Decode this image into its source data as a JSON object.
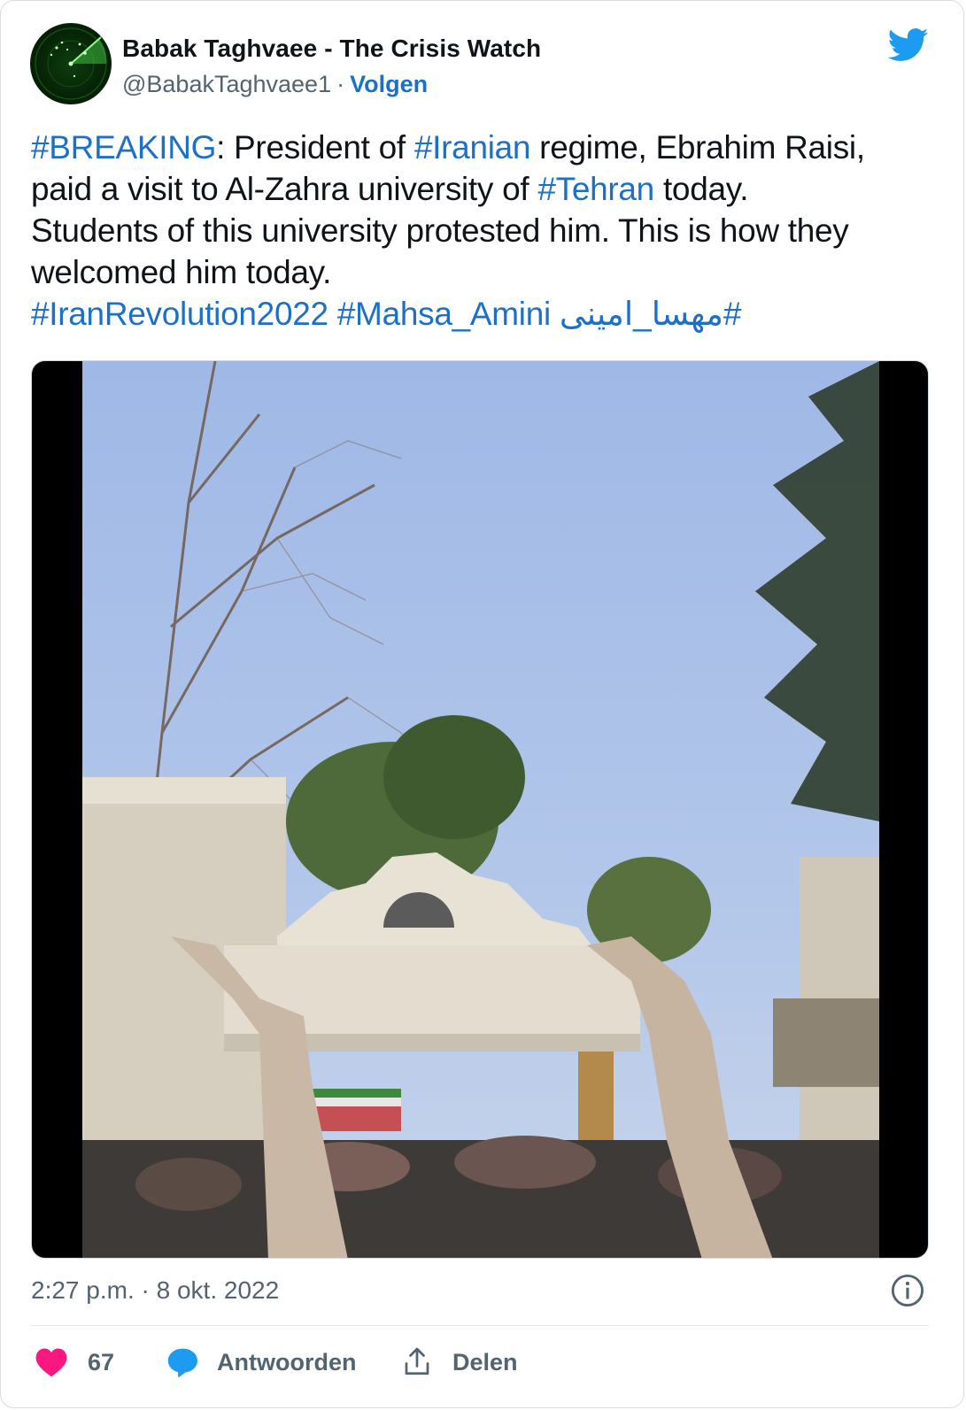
{
  "author": {
    "name": "Babak Taghvaee - The Crisis Watch",
    "handle": "@BabakTaghvaee1",
    "separator": "·",
    "follow_label": "Volgen",
    "avatar_icon": "radar-avatar-icon"
  },
  "brand": {
    "icon": "twitter-bird-icon",
    "color": "#1d9bf0"
  },
  "tweet": {
    "lines": [
      [
        {
          "text": "#BREAKING",
          "tag": true
        },
        {
          "text": ": President of ",
          "tag": false
        },
        {
          "text": "#Iranian",
          "tag": true
        },
        {
          "text": " regime, Ebrahim Raisi,",
          "tag": false
        }
      ],
      [
        {
          "text": "paid a visit to Al-Zahra university of ",
          "tag": false
        },
        {
          "text": "#Tehran",
          "tag": true
        },
        {
          "text": " today.",
          "tag": false
        }
      ],
      [
        {
          "text": "Students of this university protested him. This is how they",
          "tag": false
        }
      ],
      [
        {
          "text": "welcomed him today.",
          "tag": false
        }
      ],
      [
        {
          "text": "#IranRevolution2022",
          "tag": true
        },
        {
          "text": " ",
          "tag": false
        },
        {
          "text": "#Mahsa_Amini",
          "tag": true
        },
        {
          "text": " ",
          "tag": false
        },
        {
          "text": "#مهسا_امینی",
          "tag": true
        }
      ]
    ],
    "link_color": "#1d70c8"
  },
  "media": {
    "type": "video",
    "description_icon": "video-thumbnail"
  },
  "footer": {
    "time": "2:27 p.m.",
    "separator": "·",
    "date": "8 okt. 2022",
    "info_icon": "info-icon"
  },
  "actions": {
    "like_count": "67",
    "reply_label": "Antwoorden",
    "share_label": "Delen",
    "like_color": "#f91880",
    "reply_color": "#1d9bf0"
  }
}
